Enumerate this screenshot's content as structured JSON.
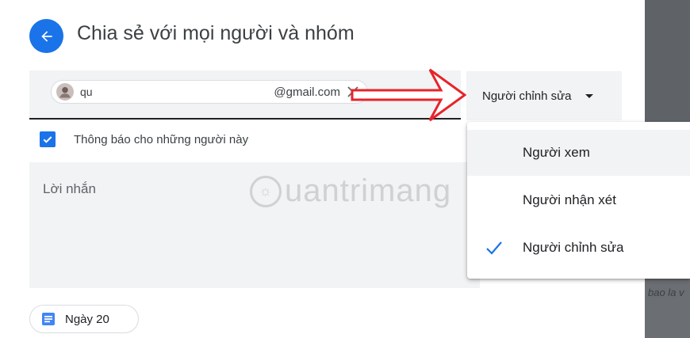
{
  "dialog": {
    "title": "Chia sẻ với mọi người và nhóm",
    "recipient": {
      "name_lead": "qu",
      "email_tail": "@gmail.com"
    },
    "role_button": "Người chỉnh sửa",
    "notify_label": "Thông báo cho những người này",
    "message_placeholder": "Lời nhắn",
    "watermark": "uantrimang",
    "file_chip_label": "Ngày 20"
  },
  "role_menu": {
    "items": [
      {
        "label": "Người xem",
        "selected": false
      },
      {
        "label": "Người nhận xét",
        "selected": false
      },
      {
        "label": "Người chỉnh sửa",
        "selected": true
      }
    ]
  },
  "background_fragment": "bao la v",
  "colors": {
    "accent": "#1a73e8",
    "arrow": "#e8232a",
    "surface": "#f1f3f4"
  },
  "icons": {
    "back": "arrow-left-icon",
    "remove": "close-icon",
    "caret": "caret-down-icon",
    "check": "checkmark-icon",
    "file": "doc-icon"
  }
}
